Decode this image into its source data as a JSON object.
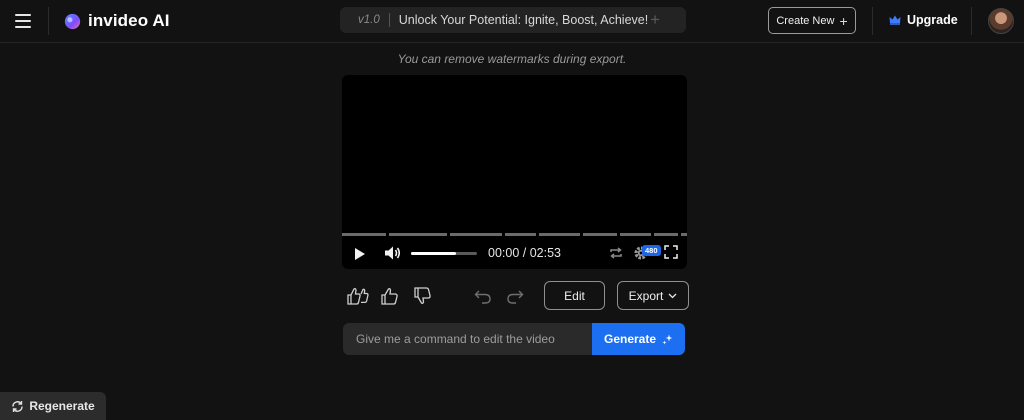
{
  "header": {
    "brand_name": "invideo AI",
    "project_version": "v1.0",
    "project_title": "Unlock Your Potential: Ignite, Boost, Achieve!",
    "create_new_label": "Create New",
    "upgrade_label": "Upgrade"
  },
  "watermark_note": "You can remove watermarks during export.",
  "player": {
    "time_display": "00:00 / 02:53",
    "quality_badge": "480",
    "volume_level": 0.68,
    "playback_progress": 0.0
  },
  "actions": {
    "edit_label": "Edit",
    "export_label": "Export"
  },
  "command": {
    "placeholder": "Give me a command to edit the video",
    "generate_label": "Generate"
  },
  "regenerate_label": "Regenerate",
  "icons": [
    "menu-icon",
    "invideo-logo-icon",
    "plus-icon",
    "crown-icon",
    "play-icon",
    "volume-icon",
    "loop-icon",
    "settings-icon",
    "fullscreen-icon",
    "double-thumbs-up-icon",
    "thumbs-up-icon",
    "thumbs-down-icon",
    "undo-icon",
    "redo-icon",
    "chevron-down-icon",
    "sparkle-icon",
    "refresh-icon"
  ],
  "colors": {
    "background": "#121212",
    "accent_blue": "#1d6ff2",
    "badge_blue": "#1e66e8"
  }
}
